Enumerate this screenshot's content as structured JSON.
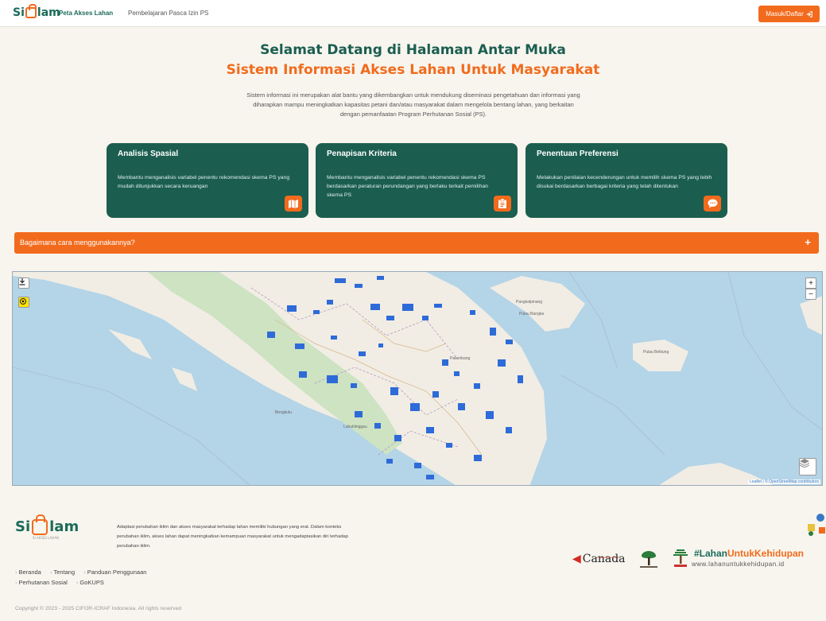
{
  "nav": {
    "logo_prefix": "Si",
    "logo_suffix": "lam",
    "links": [
      "Peta Akses Lahan",
      "Pembelajaran Pasca Izin PS"
    ],
    "login_label": "Masuk/Daftar"
  },
  "hero": {
    "title_line1": "Selamat Datang di Halaman Antar Muka",
    "title_line2": "Sistem Informasi Akses Lahan Untuk Masyarakat",
    "description": "Sistem informasi ini merupakan alat bantu yang dikembangkan untuk mendukung diseminasi pengetahuan dan informasi yang diharapkan mampu meningkatkan kapasitas petani dan/atau masyarakat dalam mengelola bentang lahan, yang berkaitan dengan pemanfaatan Program Perhutanan Sosial (PS)."
  },
  "cards": [
    {
      "title": "Analisis Spasial",
      "text": "Membantu menganalisis variabel penentu rekomendasi skema PS yang mudah ditunjukkan secara keruangan",
      "icon": "map-icon"
    },
    {
      "title": "Penapisan Kriteria",
      "text": "Membantu menganalisis variabel penentu rekomendasi skema PS berdasarkan peraturan perundangan yang berlaku terkait pemilihan skema PS",
      "icon": "clipboard-icon"
    },
    {
      "title": "Penentuan Preferensi",
      "text": "Melakukan penilaian kecenderungan untuk memilih skema PS yang lebih disukai berdasarkan berbagai kriteria yang telah ditentukan",
      "icon": "chat-icon"
    }
  ],
  "accordion": {
    "label": "Bagaimana cara menggunakannya?",
    "toggle": "+"
  },
  "map": {
    "place_labels": [
      "Pangkalpinang",
      "Pulau Bangka",
      "Palembang",
      "Pulau Belitung",
      "Bengkulu",
      "Lubuklinggau"
    ],
    "zoom_in": "+",
    "zoom_out": "−",
    "attribution_leaflet": "Leaflet",
    "attribution_osm": "© OpenStreetMap contributors",
    "colors": {
      "land": "#f1ede4",
      "sea": "#b4d4e7",
      "forest": "#cde3c2",
      "ps_area": "#2e6bd8"
    }
  },
  "footer": {
    "logo_prefix": "Si",
    "logo_suffix": "lam",
    "logo_sub": "SI AKSES LAHAN",
    "description": "Adaptasi perubahan iklim dan akses masyarakat terhadap lahan memiliki hubungan yang erat. Dalam konteks perubahan iklim, akses lahan dapat meningkatkan kemampuan masyarakat untuk mengadaptasikan diri terhadap perubahan iklim.",
    "links_row1": [
      "Beranda",
      "Tentang",
      "Panduan Penggunaan"
    ],
    "links_row2": [
      "Perhutanan Sosial",
      "GoKUPS"
    ],
    "partner_small": "in partnership with",
    "partner_canada": "Canada",
    "hashtag_part1": "#Lahan",
    "hashtag_part2": "Untuk",
    "hashtag_part3": "Kehidupan",
    "hashtag_url": "www.lahanuntukkehidupan.id",
    "copyright": "Copyright © 2023 - 2025 CIFOR-ICRAF Indonesia. All rights reserved"
  }
}
